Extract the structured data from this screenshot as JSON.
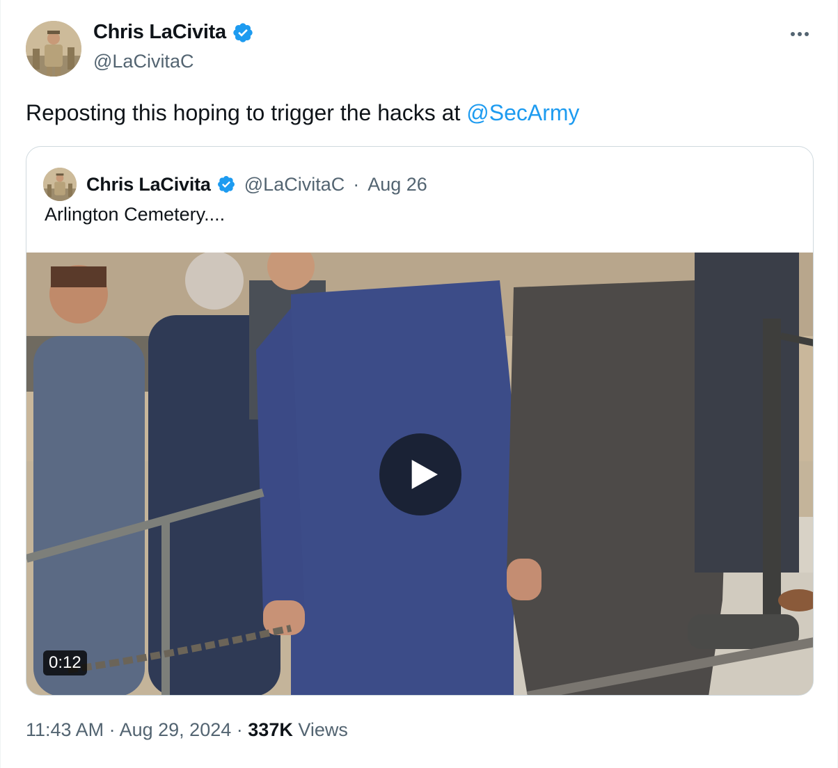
{
  "author": {
    "display_name": "Chris LaCivita",
    "handle": "@LaCivitaC",
    "verified": true
  },
  "tweet": {
    "text_prefix": "Reposting this hoping to trigger the hacks at ",
    "mention": "@SecArmy"
  },
  "quoted_tweet": {
    "display_name": "Chris LaCivita",
    "handle": "@LaCivitaC",
    "separator": "·",
    "date": "Aug 26",
    "text": "Arlington Cemetery....",
    "video": {
      "duration": "0:12"
    }
  },
  "footer": {
    "time": "11:43 AM",
    "separator1": "·",
    "date": "Aug 29, 2024",
    "separator2": "·",
    "views_count": "337K",
    "views_label": "Views"
  },
  "icons": {
    "verified_badge": "verified-badge-icon",
    "more": "more-options-icon",
    "play": "play-icon"
  },
  "colors": {
    "brand_blue": "#1d9bf0",
    "secondary_text": "#536471",
    "primary_text": "#0f1419",
    "border": "#cfd9de"
  }
}
